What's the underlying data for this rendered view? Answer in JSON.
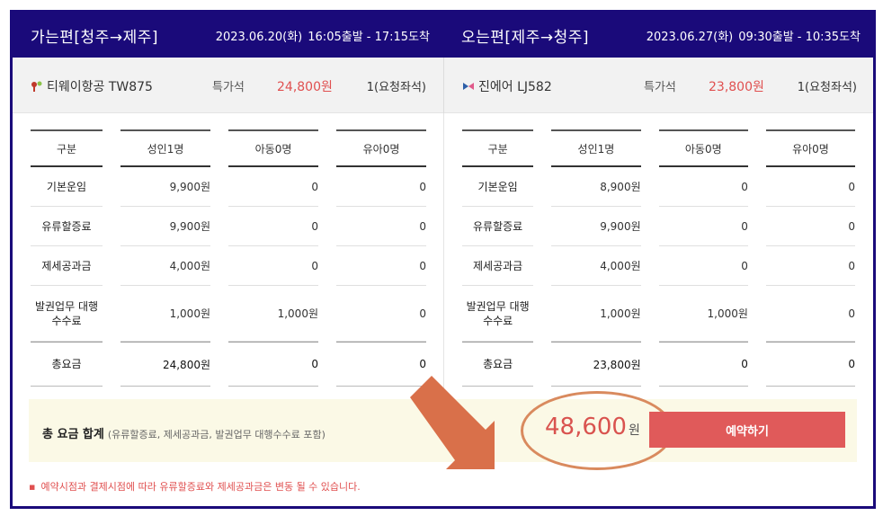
{
  "outbound": {
    "title": "가는편[청주→제주]",
    "date": "2023.06.20(화)",
    "time": "16:05출발 - 17:15도착",
    "airline": "티웨이항공 TW875",
    "seat_class": "특가석",
    "price": "24,800원",
    "seats": "1(요청좌석)",
    "logo_color": "#c0392b",
    "headers": [
      "구분",
      "성인1명",
      "아동0명",
      "유아0명"
    ],
    "rows": [
      {
        "label": "기본운임",
        "adult": "9,900원",
        "child": "0",
        "infant": "0"
      },
      {
        "label": "유류할증료",
        "adult": "9,900원",
        "child": "0",
        "infant": "0"
      },
      {
        "label": "제세공과금",
        "adult": "4,000원",
        "child": "0",
        "infant": "0"
      },
      {
        "label1": "발권업무 대행",
        "label2": "수수료",
        "adult": "1,000원",
        "child": "1,000원",
        "infant": "0"
      }
    ],
    "total": {
      "label": "총요금",
      "adult": "24,800원",
      "child": "0",
      "infant": "0"
    }
  },
  "inbound": {
    "title": "오는편[제주→청주]",
    "date": "2023.06.27(화)",
    "time": "09:30출발 - 10:35도착",
    "airline": "진에어 LJ582",
    "seat_class": "특가석",
    "price": "23,800원",
    "seats": "1(요청좌석)",
    "logo_color": "#2e5fa8",
    "headers": [
      "구분",
      "성인1명",
      "아동0명",
      "유아0명"
    ],
    "rows": [
      {
        "label": "기본운임",
        "adult": "8,900원",
        "child": "0",
        "infant": "0"
      },
      {
        "label": "유류할증료",
        "adult": "9,900원",
        "child": "0",
        "infant": "0"
      },
      {
        "label": "제세공과금",
        "adult": "4,000원",
        "child": "0",
        "infant": "0"
      },
      {
        "label1": "발권업무 대행",
        "label2": "수수료",
        "adult": "1,000원",
        "child": "1,000원",
        "infant": "0"
      }
    ],
    "total": {
      "label": "총요금",
      "adult": "23,800원",
      "child": "0",
      "infant": "0"
    }
  },
  "summary": {
    "label": "총 요금 합계",
    "note": "(유류할증료, 제세공과금, 발권업무 대행수수료 포함)",
    "amount": "48,600",
    "unit": "원",
    "book_button": "예약하기"
  },
  "notice": {
    "bullet": "▪",
    "text": "예약시점과 결제시점에 따라 유류할증료와 제세공과금은 변동 될 수 있습니다."
  },
  "colors": {
    "header_bg": "#1a0a7a",
    "accent_red": "#e05050",
    "button": "#e05a5a",
    "annotation": "#d9704a"
  }
}
